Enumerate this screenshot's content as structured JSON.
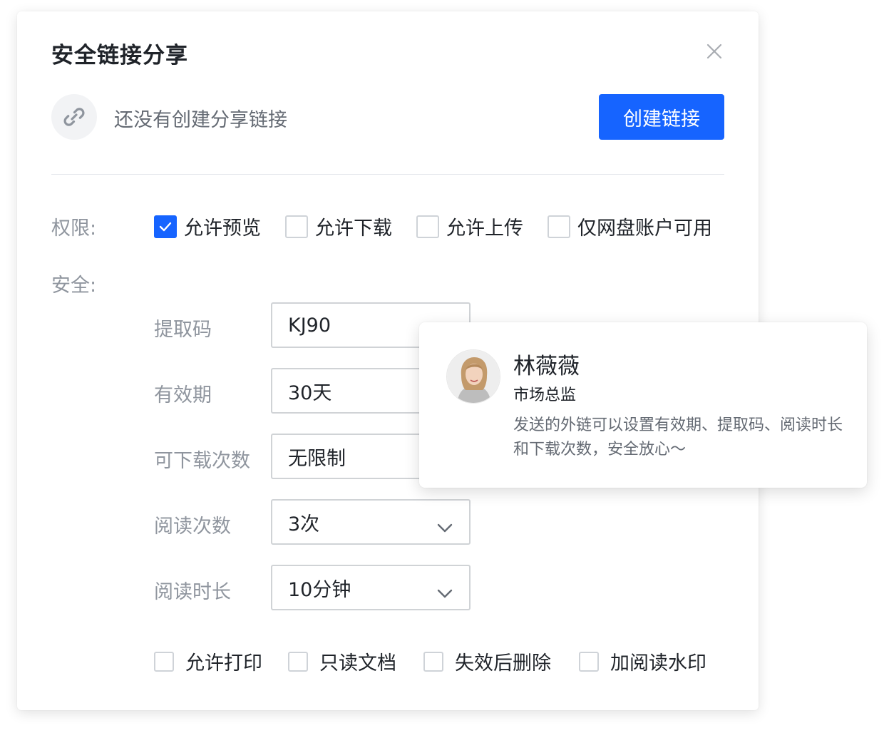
{
  "dialog": {
    "title": "安全链接分享",
    "close_icon": "close-icon",
    "no_link_text": "还没有创建分享链接",
    "link_icon": "link-icon",
    "create_button": "创建链接",
    "accent_color": "#1664ff"
  },
  "permissions": {
    "label": "权限:",
    "options": [
      {
        "label": "允许预览",
        "checked": true
      },
      {
        "label": "允许下载",
        "checked": false
      },
      {
        "label": "允许上传",
        "checked": false
      },
      {
        "label": "仅网盘账户可用",
        "checked": false
      }
    ]
  },
  "security": {
    "label": "安全:",
    "fields": [
      {
        "label": "提取码",
        "value": "KJ90",
        "dropdown": false
      },
      {
        "label": "有效期",
        "value": "30天",
        "dropdown": true
      },
      {
        "label": "可下载次数",
        "value": "无限制",
        "dropdown": true
      },
      {
        "label": "阅读次数",
        "value": "3次",
        "dropdown": true
      },
      {
        "label": "阅读时长",
        "value": "10分钟",
        "dropdown": true
      }
    ],
    "options": [
      {
        "label": "允许打印",
        "checked": false
      },
      {
        "label": "只读文档",
        "checked": false
      },
      {
        "label": "失效后删除",
        "checked": false
      },
      {
        "label": "加阅读水印",
        "checked": false
      }
    ]
  },
  "popover": {
    "name": "林薇薇",
    "role": "市场总监",
    "description": "发送的外链可以设置有效期、提取码、阅读时长和下载次数，安全放心～"
  }
}
